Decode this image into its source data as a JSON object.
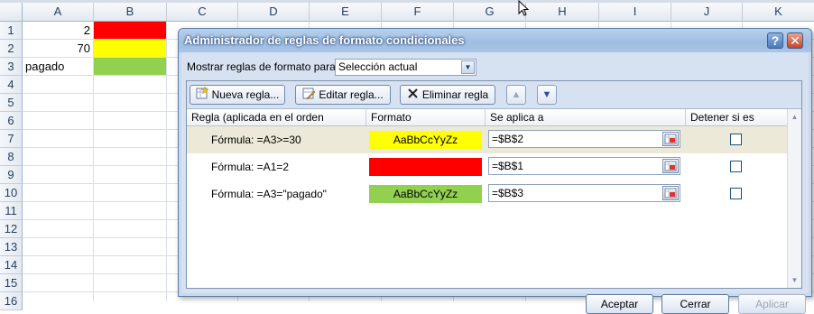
{
  "sheet": {
    "columns": [
      "A",
      "B",
      "C",
      "D",
      "E",
      "F",
      "G",
      "H",
      "I",
      "J",
      "K"
    ],
    "rows": [
      "1",
      "2",
      "3",
      "4",
      "5",
      "6",
      "7",
      "8",
      "9",
      "10",
      "11",
      "12",
      "13",
      "14",
      "15",
      "16"
    ],
    "cells": {
      "A1": "2",
      "A2": "70",
      "A3": "pagado"
    },
    "fill_colors": {
      "B1": "#ff0000",
      "B2": "#ffff00",
      "B3": "#92d050"
    }
  },
  "dialog": {
    "title": "Administrador de reglas de formato condicionales",
    "help_label": "?",
    "close_label": "✕",
    "show_rules_label": "Mostrar reglas de formato para:",
    "show_rules_value": "Selección actual",
    "toolbar": {
      "new_rule": "Nueva regla...",
      "edit_rule": "Editar regla...",
      "delete_rule": "Eliminar regla",
      "up_icon": "arrow-up-icon",
      "down_icon": "arrow-down-icon"
    },
    "columns": {
      "rule": "Regla (aplicada en el orden mostrado)",
      "format": "Formato",
      "applies_to": "Se aplica a",
      "stop_if_true": "Detener si es verdad"
    },
    "rules": [
      {
        "rule": "Fórmula: =A3>=30",
        "preview": "AaBbCcYyZz",
        "fill": "#ffff00",
        "applies_to": "=$B$2",
        "stop": false
      },
      {
        "rule": "Fórmula: =A1=2",
        "preview": "",
        "fill": "#ff0000",
        "applies_to": "=$B$1",
        "stop": false
      },
      {
        "rule": "Fórmula: =A3=\"pagado\"",
        "preview": "AaBbCcYyZz",
        "fill": "#92d050",
        "applies_to": "=$B$3",
        "stop": false
      }
    ],
    "buttons": {
      "ok": "Aceptar",
      "close": "Cerrar",
      "apply": "Aplicar"
    }
  }
}
